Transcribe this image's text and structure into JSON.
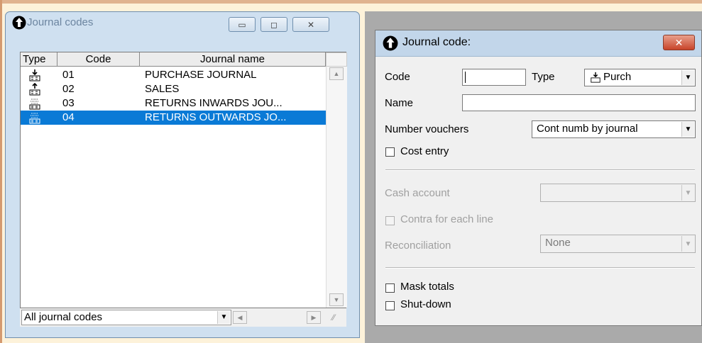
{
  "journal_codes_window": {
    "title": "Journal codes",
    "columns": [
      "Type",
      "Code",
      "Journal name"
    ],
    "rows": [
      {
        "type_icon": "purchase-icon",
        "code": "01",
        "name": "PURCHASE JOURNAL",
        "selected": false
      },
      {
        "type_icon": "sales-icon",
        "code": "02",
        "name": "SALES",
        "selected": false
      },
      {
        "type_icon": "returns-icon",
        "code": "03",
        "name": "RETURNS INWARDS JOU...",
        "selected": false
      },
      {
        "type_icon": "returns-icon",
        "code": "04",
        "name": "RETURNS OUTWARDS JO...",
        "selected": true
      }
    ],
    "filter_value": "All journal codes"
  },
  "journal_code_dialog": {
    "title": "Journal code:",
    "code_label": "Code",
    "code_value": "",
    "type_label": "Type",
    "type_value": "Purch",
    "name_label": "Name",
    "name_value": "",
    "number_vouchers_label": "Number vouchers",
    "number_vouchers_value": "Cont numb by journal",
    "cost_entry_label": "Cost entry",
    "cash_account_label": "Cash account",
    "cash_account_value": "",
    "contra_label": "Contra for each line",
    "reconciliation_label": "Reconciliation",
    "reconciliation_value": "None",
    "mask_totals_label": "Mask totals",
    "shut_down_label": "Shut-down"
  },
  "colors": {
    "selection": "#0a7ad6",
    "close_button": "#c8442a",
    "desktop": "#aaaaaa"
  }
}
